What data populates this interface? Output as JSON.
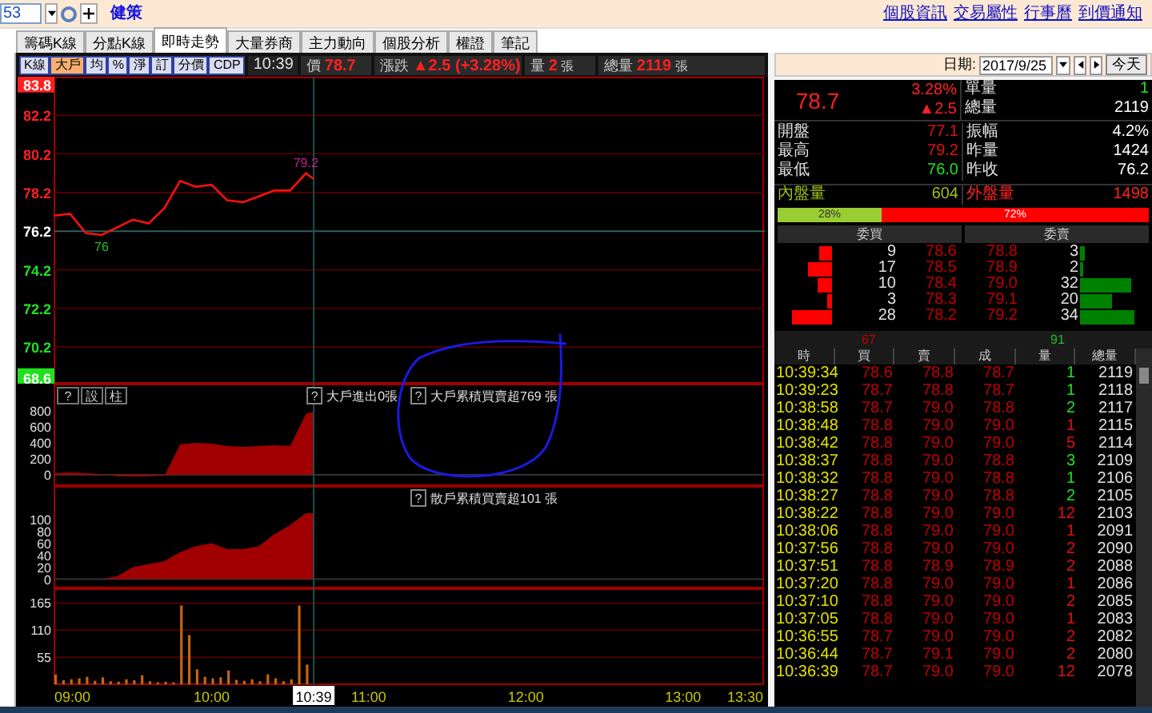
{
  "top_bar": {
    "symbol_input": "53",
    "stock_name": "健策",
    "links": [
      "個股資訊",
      "交易屬性",
      "行事曆",
      "到價通知"
    ]
  },
  "tabs": [
    {
      "label": "籌碼K線",
      "selected": false
    },
    {
      "label": "分點K線",
      "selected": false
    },
    {
      "label": "即時走勢",
      "selected": true
    },
    {
      "label": "大量券商",
      "selected": false
    },
    {
      "label": "主力動向",
      "selected": false
    },
    {
      "label": "個股分析",
      "selected": false
    },
    {
      "label": "權證",
      "selected": false
    },
    {
      "label": "筆記",
      "selected": false
    }
  ],
  "toolbar": {
    "buttons": [
      {
        "label": "K線",
        "selected": false
      },
      {
        "label": "大戶",
        "selected": true
      },
      {
        "label": "均",
        "selected": false
      },
      {
        "label": "%",
        "selected": false
      },
      {
        "label": "淨",
        "selected": false
      },
      {
        "label": "訂",
        "selected": false
      },
      {
        "label": "分價",
        "selected": false
      },
      {
        "label": "CDP",
        "selected": false
      }
    ],
    "time": "10:39",
    "fields": [
      {
        "label": "價",
        "value": "78.7"
      },
      {
        "label": "漲跌",
        "value": "▲2.5 (+3.28%)"
      },
      {
        "label": "量",
        "value": "2",
        "unit": "張"
      },
      {
        "label": "總量",
        "value": "2119",
        "unit": "張"
      }
    ]
  },
  "date_bar": {
    "label": "日期:",
    "value": "2017/9/25",
    "today_button": "今天"
  },
  "quote": {
    "price": "78.7",
    "change_pct": "3.28%",
    "change": "▲2.5",
    "side": [
      {
        "label": "單量",
        "value": "1",
        "color": "#20e020"
      },
      {
        "label": "總量",
        "value": "2119",
        "color": "#ffffff"
      }
    ],
    "stats": [
      {
        "label": "開盤",
        "value": "77.1",
        "color": "#e01010"
      },
      {
        "label": "振幅",
        "value": "4.2%",
        "color": "#ffffff"
      },
      {
        "label": "最高",
        "value": "79.2",
        "color": "#e01010"
      },
      {
        "label": "昨量",
        "value": "1424",
        "color": "#ffffff"
      },
      {
        "label": "最低",
        "value": "76.0",
        "color": "#20e020"
      },
      {
        "label": "昨收",
        "value": "76.2",
        "color": "#ffffff"
      },
      {
        "label": "內盤量",
        "value": "604",
        "color": "#9cbf1c"
      },
      {
        "label": "外盤量",
        "value": "1498",
        "color": "#ff2020"
      }
    ]
  },
  "ratio_bar": {
    "buy_label": "28%",
    "sell_label": "72%",
    "level": 0.28
  },
  "order_book": {
    "bid_header": "委買",
    "ask_header": "委賣",
    "rows": [
      {
        "bid_qty": "9",
        "bid": "78.6",
        "ask": "78.8",
        "ask_qty": "3"
      },
      {
        "bid_qty": "17",
        "bid": "78.5",
        "ask": "78.9",
        "ask_qty": "2"
      },
      {
        "bid_qty": "10",
        "bid": "78.4",
        "ask": "79.0",
        "ask_qty": "32"
      },
      {
        "bid_qty": "3",
        "bid": "78.3",
        "ask": "79.1",
        "ask_qty": "20"
      },
      {
        "bid_qty": "28",
        "bid": "78.2",
        "ask": "79.2",
        "ask_qty": "34"
      }
    ],
    "bid_total": "67",
    "ask_total": "91"
  },
  "trades": {
    "columns": [
      "時",
      "買",
      "賣",
      "成",
      "量",
      "總量"
    ],
    "rows": [
      {
        "time": "10:39:34",
        "bid": "78.6",
        "ask": "78.8",
        "price": "78.7",
        "qty": "1",
        "total": "2119",
        "color": "#20e020"
      },
      {
        "time": "10:39:23",
        "bid": "78.7",
        "ask": "78.8",
        "price": "78.7",
        "qty": "1",
        "total": "2118",
        "color": "#20e020"
      },
      {
        "time": "10:38:58",
        "bid": "78.7",
        "ask": "79.0",
        "price": "78.8",
        "qty": "2",
        "total": "2117",
        "color": "#20e020"
      },
      {
        "time": "10:38:48",
        "bid": "78.8",
        "ask": "79.0",
        "price": "79.0",
        "qty": "1",
        "total": "2115",
        "color": "#e01010"
      },
      {
        "time": "10:38:42",
        "bid": "78.8",
        "ask": "79.0",
        "price": "79.0",
        "qty": "5",
        "total": "2114",
        "color": "#e01010"
      },
      {
        "time": "10:38:37",
        "bid": "78.8",
        "ask": "79.0",
        "price": "78.8",
        "qty": "3",
        "total": "2109",
        "color": "#20e020"
      },
      {
        "time": "10:38:32",
        "bid": "78.8",
        "ask": "79.0",
        "price": "78.8",
        "qty": "1",
        "total": "2106",
        "color": "#20e020"
      },
      {
        "time": "10:38:27",
        "bid": "78.8",
        "ask": "79.0",
        "price": "78.8",
        "qty": "2",
        "total": "2105",
        "color": "#20e020"
      },
      {
        "time": "10:38:22",
        "bid": "78.8",
        "ask": "79.0",
        "price": "79.0",
        "qty": "12",
        "total": "2103",
        "color": "#e01010"
      },
      {
        "time": "10:38:06",
        "bid": "78.8",
        "ask": "79.0",
        "price": "79.0",
        "qty": "1",
        "total": "2091",
        "color": "#e01010"
      },
      {
        "time": "10:37:56",
        "bid": "78.8",
        "ask": "79.0",
        "price": "79.0",
        "qty": "2",
        "total": "2090",
        "color": "#e01010"
      },
      {
        "time": "10:37:51",
        "bid": "78.8",
        "ask": "78.9",
        "price": "78.9",
        "qty": "2",
        "total": "2088",
        "color": "#e01010"
      },
      {
        "time": "10:37:20",
        "bid": "78.8",
        "ask": "79.0",
        "price": "79.0",
        "qty": "1",
        "total": "2086",
        "color": "#e01010"
      },
      {
        "time": "10:37:10",
        "bid": "78.8",
        "ask": "79.0",
        "price": "79.0",
        "qty": "2",
        "total": "2085",
        "color": "#e01010"
      },
      {
        "time": "10:37:05",
        "bid": "78.8",
        "ask": "79.0",
        "price": "79.0",
        "qty": "1",
        "total": "2083",
        "color": "#e01010"
      },
      {
        "time": "10:36:55",
        "bid": "78.7",
        "ask": "79.0",
        "price": "79.0",
        "qty": "2",
        "total": "2082",
        "color": "#e01010"
      },
      {
        "time": "10:36:44",
        "bid": "78.7",
        "ask": "79.1",
        "price": "79.0",
        "qty": "2",
        "total": "2080",
        "color": "#e01010"
      },
      {
        "time": "10:36:39",
        "bid": "78.7",
        "ask": "79.0",
        "price": "79.0",
        "qty": "12",
        "total": "2078",
        "color": "#e01010"
      }
    ]
  },
  "price_panel": {
    "chart_data": {
      "type": "line",
      "grid": true,
      "ref_lines": [
        {
          "axis": "y",
          "value": 76.2
        },
        {
          "axis": "x",
          "value": 10.65
        }
      ],
      "x": [
        9.0,
        9.1,
        9.2,
        9.3,
        9.4,
        9.5,
        9.6,
        9.7,
        9.8,
        9.9,
        10.0,
        10.1,
        10.2,
        10.3,
        10.4,
        10.5,
        10.6,
        10.65
      ],
      "series": [
        {
          "color": "#ff1010",
          "values": [
            77.0,
            77.1,
            76.1,
            76.0,
            76.4,
            76.8,
            76.6,
            77.4,
            78.8,
            78.5,
            78.6,
            77.8,
            77.7,
            78.0,
            78.3,
            78.3,
            79.2,
            78.9
          ]
        }
      ],
      "xlim": [
        9,
        13.5
      ],
      "ylim": [
        68.3,
        84.2
      ],
      "yticks": [
        {
          "value": 83.8,
          "label": "83.8"
        },
        {
          "value": 82.2,
          "label": "82.2"
        },
        {
          "value": 80.2,
          "label": "80.2"
        },
        {
          "value": 78.2,
          "label": "78.2"
        },
        {
          "value": 76.2,
          "label": "76.2"
        },
        {
          "value": 74.2,
          "label": "74.2"
        },
        {
          "value": 72.2,
          "label": "72.2"
        },
        {
          "value": 70.2,
          "label": "70.2"
        },
        {
          "value": 68.6,
          "label": "68.6"
        }
      ],
      "annotations": [
        {
          "x": 10.6,
          "y": 79.2,
          "text": "79.2"
        },
        {
          "x": 9.3,
          "y": 76.0,
          "text": "76"
        }
      ]
    }
  },
  "main_force_panel": {
    "buttons": [
      "?",
      "設",
      "柱"
    ],
    "labels": [
      {
        "help": "?",
        "text": "大戶進出0張"
      },
      {
        "help": "?",
        "text": "大戶累積買賣超769 張"
      }
    ],
    "chart_data": {
      "type": "area",
      "ref_lines": [
        {
          "axis": "x",
          "value": 10.65
        }
      ],
      "x": [
        9.0,
        9.1,
        9.2,
        9.3,
        9.4,
        9.5,
        9.6,
        9.7,
        9.8,
        9.9,
        10.0,
        10.1,
        10.2,
        10.3,
        10.4,
        10.5,
        10.6,
        10.65
      ],
      "series": [
        {
          "color": "#a00000",
          "values": [
            20,
            30,
            20,
            10,
            -20,
            -20,
            -20,
            -10,
            380,
            400,
            390,
            360,
            350,
            360,
            370,
            360,
            760,
            790
          ]
        }
      ],
      "xlim": [
        9,
        13.5
      ],
      "ylim": [
        -100,
        1100
      ],
      "yticks": [
        0,
        200,
        400,
        600,
        800
      ]
    }
  },
  "retail_panel": {
    "labels": [
      {
        "help": "?",
        "text": "散戶累積買賣超101 張"
      }
    ],
    "chart_data": {
      "type": "area",
      "ref_lines": [
        {
          "axis": "x",
          "value": 10.65
        }
      ],
      "x": [
        9.0,
        9.1,
        9.2,
        9.3,
        9.4,
        9.5,
        9.6,
        9.7,
        9.8,
        9.9,
        10.0,
        10.1,
        10.2,
        10.3,
        10.4,
        10.5,
        10.6,
        10.65
      ],
      "series": [
        {
          "color": "#a00000",
          "values": [
            0,
            0,
            0,
            0,
            5,
            20,
            25,
            30,
            45,
            55,
            60,
            50,
            50,
            55,
            75,
            90,
            110,
            110
          ]
        }
      ],
      "xlim": [
        9,
        13.5
      ],
      "ylim": [
        -10,
        150
      ],
      "yticks": [
        0,
        20,
        40,
        60,
        80,
        100
      ]
    }
  },
  "volume_panel": {
    "chart_data": {
      "type": "bar",
      "grid": true,
      "x": [
        9.0,
        9.05,
        9.1,
        9.15,
        9.2,
        9.25,
        9.3,
        9.35,
        9.4,
        9.45,
        9.5,
        9.55,
        9.6,
        9.65,
        9.7,
        9.75,
        9.8,
        9.85,
        9.9,
        9.95,
        10.0,
        10.05,
        10.1,
        10.15,
        10.2,
        10.25,
        10.3,
        10.35,
        10.4,
        10.45,
        10.5,
        10.55,
        10.6
      ],
      "series": [
        {
          "color": "#c86414",
          "values": [
            20,
            8,
            10,
            12,
            15,
            7,
            14,
            6,
            5,
            10,
            8,
            18,
            6,
            4,
            5,
            4,
            160,
            100,
            30,
            15,
            12,
            14,
            28,
            9,
            7,
            10,
            6,
            20,
            12,
            6,
            10,
            160,
            40
          ]
        }
      ],
      "xlim": [
        9,
        13.5
      ],
      "ylim": [
        0,
        195
      ],
      "yticks": [
        55,
        110,
        165
      ],
      "xticks": [
        {
          "value": 9,
          "label": "09:00"
        },
        {
          "value": 10,
          "label": "10:00"
        },
        {
          "value": 11,
          "label": "11:00"
        },
        {
          "value": 12,
          "label": "12:00"
        },
        {
          "value": 13,
          "label": "13:00"
        },
        {
          "value": 13.5,
          "label": "13:30"
        }
      ],
      "annotations": [
        {
          "x": 10.65,
          "text": "10:39"
        }
      ]
    }
  }
}
